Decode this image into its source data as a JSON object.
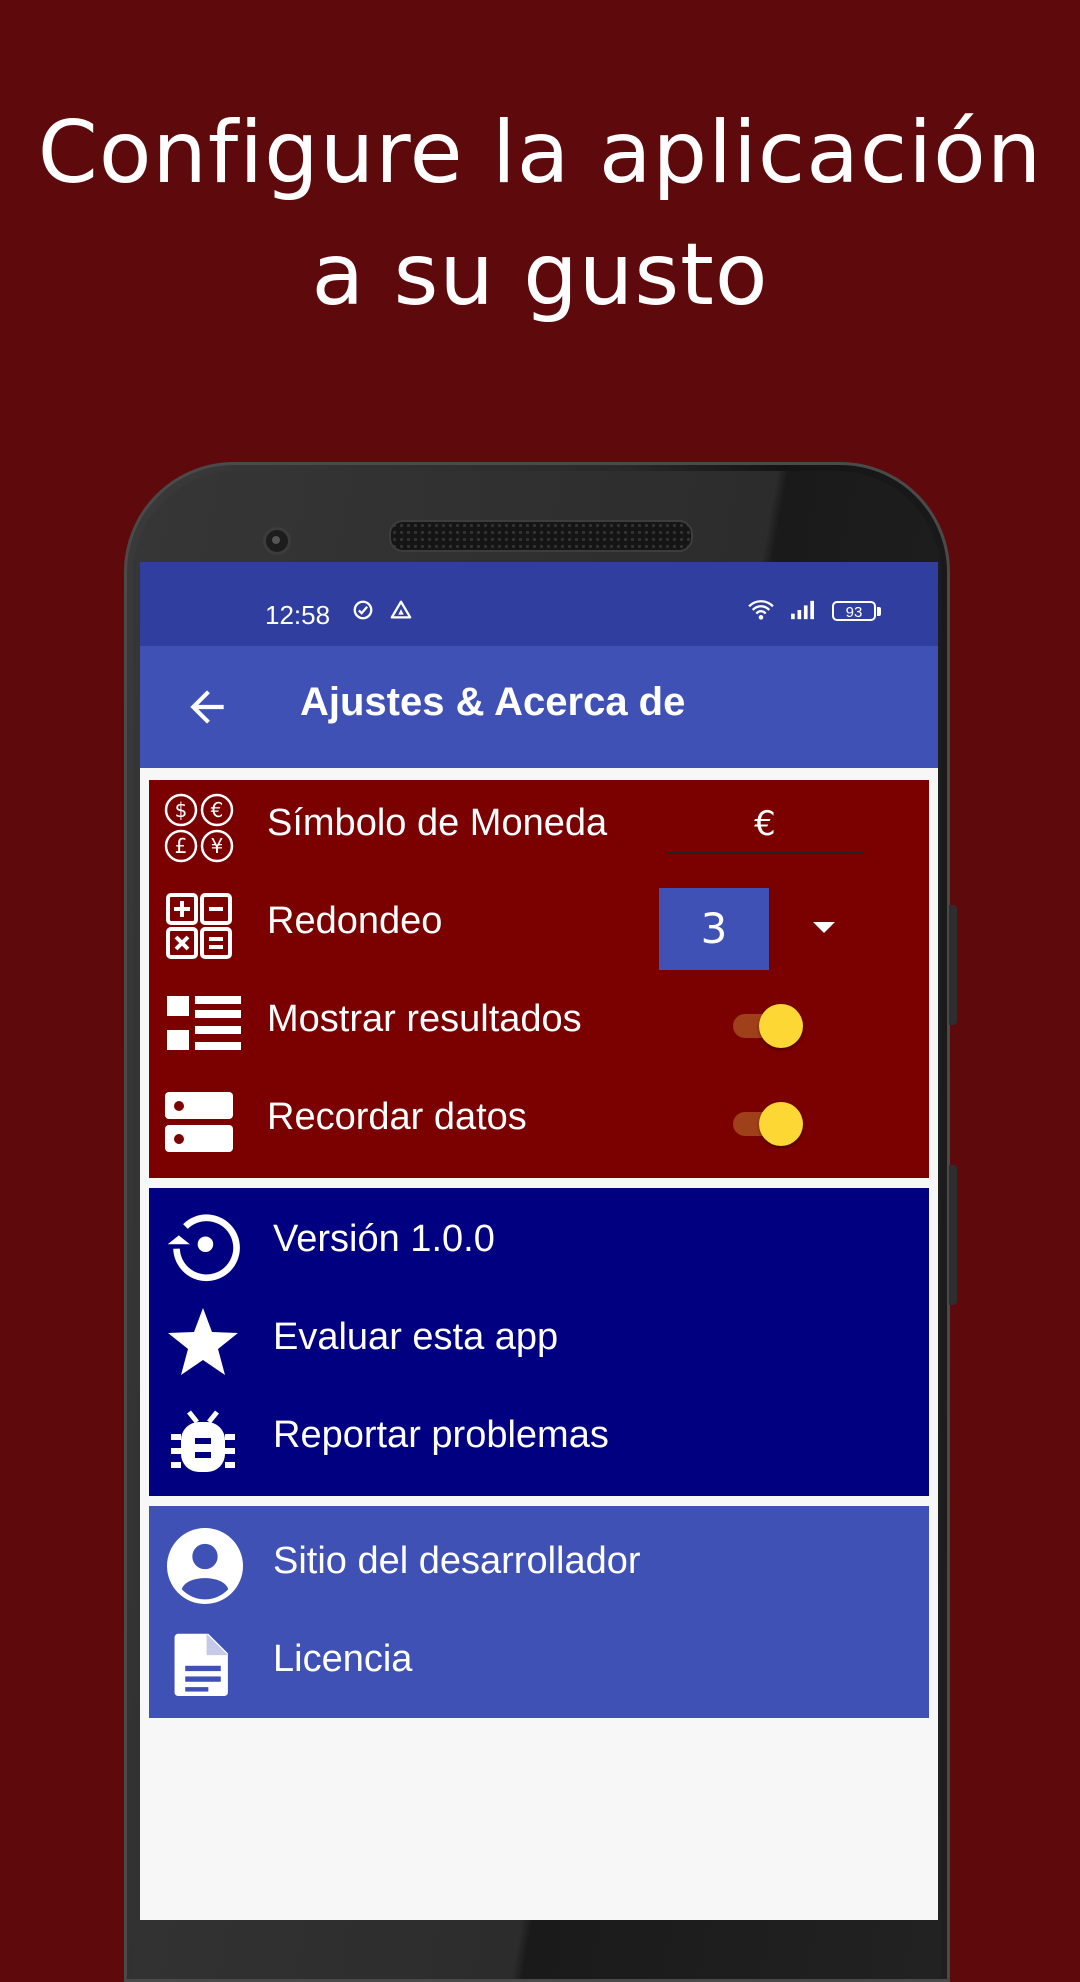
{
  "promo": {
    "line1": "Configure la aplicación",
    "line2": "a su gusto"
  },
  "statusbar": {
    "time": "12:58",
    "battery": "93",
    "icons": [
      "check-circle-icon",
      "drive-icon",
      "wifi-icon",
      "signal-icon",
      "battery-icon"
    ]
  },
  "appbar": {
    "title": "Ajustes & Acerca de",
    "back_icon": "arrow-back-icon"
  },
  "settings": {
    "currency": {
      "label": "Símbolo de Moneda",
      "value": "€",
      "icon": "currency-symbols-icon"
    },
    "rounding": {
      "label": "Redondeo",
      "value": "3",
      "icon": "calculator-icon"
    },
    "show_results": {
      "label": "Mostrar resultados",
      "checked": true,
      "icon": "list-icon"
    },
    "remember_data": {
      "label": "Recordar datos",
      "checked": true,
      "icon": "storage-icon"
    }
  },
  "about": {
    "version": {
      "label": "Versión 1.0.0",
      "icon": "history-icon"
    },
    "rate": {
      "label": "Evaluar esta app",
      "icon": "star-icon"
    },
    "report": {
      "label": "Reportar problemas",
      "icon": "bug-icon"
    }
  },
  "links": {
    "developer": {
      "label": "Sitio del desarrollador",
      "icon": "account-circle-icon"
    },
    "license": {
      "label": "Licencia",
      "icon": "document-icon"
    }
  },
  "colors": {
    "background": "#5e0a0c",
    "statusbar": "#303f9f",
    "primary": "#3f51b5",
    "settings_card": "#7b0000",
    "about_card": "#000080",
    "switch_thumb": "#fdd835"
  }
}
